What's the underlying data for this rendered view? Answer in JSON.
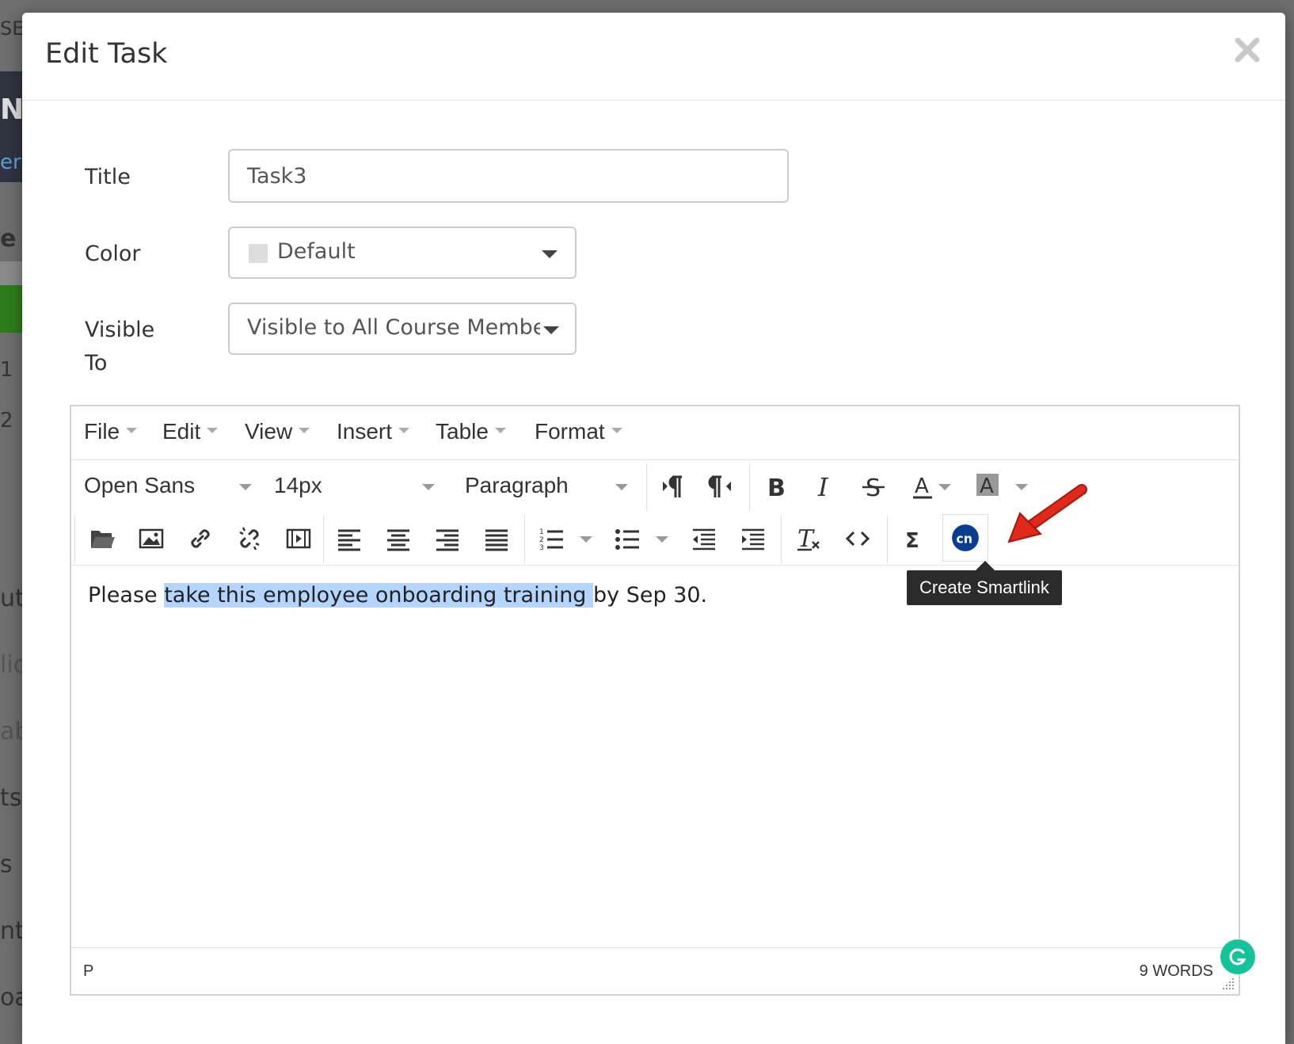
{
  "background": {
    "fragments": [
      "SE",
      "N",
      "er",
      "e",
      "1",
      "2",
      "ut",
      "lic",
      "ab",
      "ts",
      "s",
      "nts",
      "oa"
    ]
  },
  "modal": {
    "title": "Edit Task",
    "close_icon": "close-icon"
  },
  "form": {
    "title_label": "Title",
    "title_value": "Task3",
    "color_label": "Color",
    "color_value": "Default",
    "visible_label_line1": "Visible",
    "visible_label_line2": "To",
    "visible_value": "Visible to All Course Membe"
  },
  "editor": {
    "menu": {
      "file": "File",
      "edit": "Edit",
      "view": "View",
      "insert": "Insert",
      "table": "Table",
      "format": "Format"
    },
    "font_family": "Open Sans",
    "font_size": "14px",
    "block_format": "Paragraph",
    "content": {
      "before": "Please ",
      "selected": "take this employee onboarding training ",
      "after": "by Sep 30."
    },
    "status_path": "P",
    "word_count": "9 WORDS"
  },
  "tooltip": "Create Smartlink",
  "colors": {
    "selection": "#b4d5fe",
    "smartlink_blue": "#0a3d8f",
    "grammarly_green": "#15c39a",
    "arrow_red": "#e0281b"
  }
}
